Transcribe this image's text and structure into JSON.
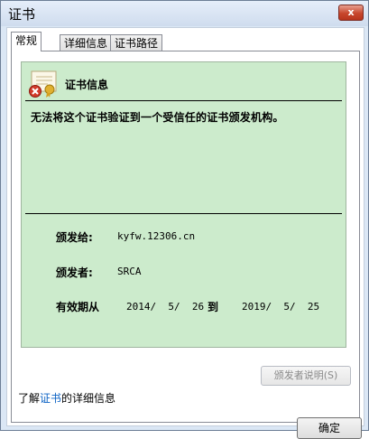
{
  "window": {
    "title": "证书",
    "close_label": "x"
  },
  "tabs": [
    {
      "label": "常规",
      "active": true
    },
    {
      "label": "详细信息",
      "active": false
    },
    {
      "label": "证书路径",
      "active": false
    }
  ],
  "certificate": {
    "header": "证书信息",
    "warning": "无法将这个证书验证到一个受信任的证书颁发机构。",
    "issued_to_label": "颁发给:",
    "issued_to_value": "kyfw.12306.cn",
    "issued_by_label": "颁发者:",
    "issued_by_value": "SRCA",
    "validity_label": "有效期从",
    "valid_from": "2014/  5/  26",
    "to_label": "到",
    "valid_to": "2019/  5/  25"
  },
  "issuer_statement_button": "颁发者说明(S)",
  "learn_more": {
    "prefix": "了解",
    "link": "证书",
    "suffix": "的详细信息"
  },
  "ok_button": "确定",
  "icons": {
    "certificate": "certificate-error-icon",
    "close": "close-icon"
  },
  "colors": {
    "cert_panel": "#ccebcc",
    "close_button": "#c7462c",
    "link": "#0b62c4"
  }
}
